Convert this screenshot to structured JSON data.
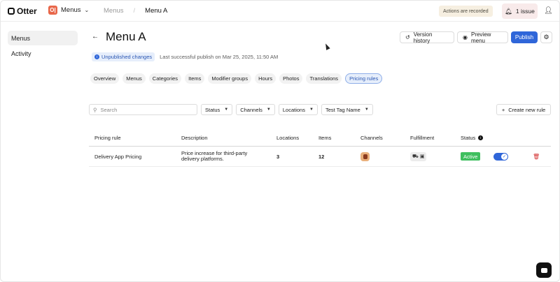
{
  "brand": {
    "name": "Otter"
  },
  "app_switcher": {
    "icon_text": "O|",
    "label": "Menus"
  },
  "breadcrumb": {
    "parent": "Menus",
    "separator": "/",
    "current": "Menu A"
  },
  "header_right": {
    "recording_badge": "Actions are recorded",
    "issue_label": "1 issue"
  },
  "sidebar": {
    "items": [
      {
        "label": "Menus",
        "active": true
      },
      {
        "label": "Activity",
        "active": false
      }
    ]
  },
  "page": {
    "title": "Menu A",
    "back_icon": "arrow-left-icon",
    "version_history_label": "Version history",
    "preview_menu_label": "Preview menu",
    "publish_label": "Publish",
    "unpublished_label": "Unpublished changes",
    "last_publish_text": "Last successful publish on Mar 25, 2025, 11:50 AM"
  },
  "tabs": [
    {
      "label": "Overview"
    },
    {
      "label": "Menus"
    },
    {
      "label": "Categories"
    },
    {
      "label": "Items"
    },
    {
      "label": "Modifier groups"
    },
    {
      "label": "Hours"
    },
    {
      "label": "Photos"
    },
    {
      "label": "Translations"
    },
    {
      "label": "Pricing rules",
      "active": true
    }
  ],
  "filters": {
    "search_placeholder": "Search",
    "status_label": "Status",
    "channels_label": "Channels",
    "locations_label": "Locations",
    "tag_label": "Test Tag Name",
    "create_rule_label": "Create new rule"
  },
  "table": {
    "headers": {
      "rule": "Pricing rule",
      "description": "Description",
      "locations": "Locations",
      "items": "Items",
      "channels": "Channels",
      "fulfillment": "Fulfillment",
      "status": "Status"
    },
    "rows": [
      {
        "rule": "Delivery App Pricing",
        "description": "Price increase for third-party delivery platforms.",
        "locations": "3",
        "items": "12",
        "status": "Active",
        "enabled": true
      }
    ]
  },
  "colors": {
    "accent": "#2f66d9",
    "active_green": "#3fbf5f",
    "delete_red": "#d32f2f"
  }
}
